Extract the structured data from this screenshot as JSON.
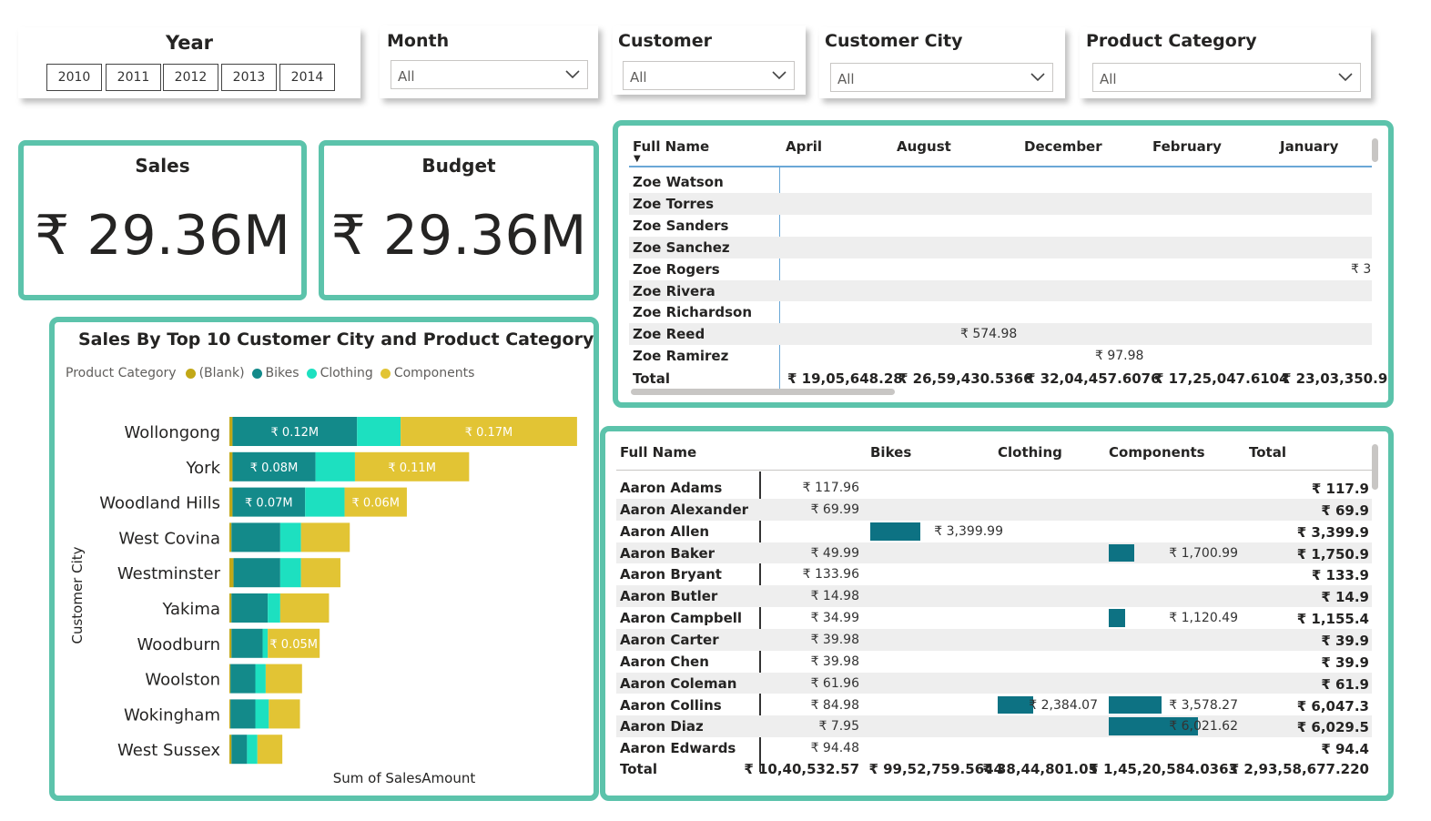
{
  "slicers": {
    "year": {
      "title": "Year",
      "options": [
        "2010",
        "2011",
        "2012",
        "2013",
        "2014"
      ]
    },
    "month": {
      "title": "Month",
      "value": "All"
    },
    "customer": {
      "title": "Customer",
      "value": "All"
    },
    "customer_city": {
      "title": "Customer City",
      "value": "All"
    },
    "product_category": {
      "title": "Product Category",
      "value": "All"
    }
  },
  "cards": {
    "sales": {
      "title": "Sales",
      "value": "₹ 29.36M"
    },
    "budget": {
      "title": "Budget",
      "value": "₹ 29.36M"
    }
  },
  "colors": {
    "accent": "#5cc3ab",
    "blank": "#c2a817",
    "bikes": "#138a8a",
    "clothing": "#1de0c0",
    "components": "#e2c434"
  },
  "chart_data": {
    "type": "bar",
    "title": "Sales By Top 10 Customer City and Product Category",
    "xlabel": "Sum of SalesAmount",
    "ylabel": "Customer City",
    "legend_title": "Product Category",
    "categories": [
      "Wollongong",
      "York",
      "Woodland Hills",
      "West Covina",
      "Westminster",
      "Yakima",
      "Woodburn",
      "Woolston",
      "Wokingham",
      "West Sussex"
    ],
    "series": [
      {
        "name": "(Blank)",
        "values": [
          0.003,
          0.003,
          0.003,
          0.002,
          0.004,
          0.002,
          0.002,
          0.001,
          0.001,
          0.002
        ]
      },
      {
        "name": "Bikes",
        "values": [
          0.12,
          0.08,
          0.07,
          0.047,
          0.045,
          0.035,
          0.03,
          0.024,
          0.024,
          0.015
        ]
      },
      {
        "name": "Clothing",
        "values": [
          0.042,
          0.038,
          0.038,
          0.02,
          0.02,
          0.012,
          0.005,
          0.01,
          0.013,
          0.01
        ]
      },
      {
        "name": "Components",
        "values": [
          0.17,
          0.11,
          0.06,
          0.047,
          0.038,
          0.047,
          0.05,
          0.035,
          0.03,
          0.024
        ]
      }
    ],
    "data_labels": [
      [
        "₹ 0.12M",
        "₹ 0.17M"
      ],
      [
        "₹ 0.08M",
        "₹ 0.11M"
      ],
      [
        "₹ 0.07M",
        "₹ 0.06M"
      ],
      [],
      [],
      [],
      [
        "",
        "₹ 0.05M"
      ],
      [],
      [],
      []
    ]
  },
  "matrix_months": {
    "headers": [
      "Full Name",
      "April",
      "August",
      "December",
      "February",
      "January"
    ],
    "rows": [
      {
        "name": "Zoe Watson",
        "cells": [
          "",
          "",
          "",
          "",
          ""
        ]
      },
      {
        "name": "Zoe Torres",
        "cells": [
          "",
          "",
          "",
          "",
          ""
        ]
      },
      {
        "name": "Zoe Sanders",
        "cells": [
          "",
          "",
          "",
          "",
          ""
        ]
      },
      {
        "name": "Zoe Sanchez",
        "cells": [
          "",
          "",
          "",
          "",
          ""
        ]
      },
      {
        "name": "Zoe Rogers",
        "cells": [
          "",
          "",
          "",
          "",
          "₹ 3"
        ]
      },
      {
        "name": "Zoe Rivera",
        "cells": [
          "",
          "",
          "",
          "",
          ""
        ]
      },
      {
        "name": "Zoe Richardson",
        "cells": [
          "",
          "",
          "",
          "",
          ""
        ]
      },
      {
        "name": "Zoe Reed",
        "cells": [
          "",
          "₹ 574.98",
          "",
          "",
          ""
        ]
      },
      {
        "name": "Zoe Ramirez",
        "cells": [
          "",
          "",
          "₹ 97.98",
          "",
          ""
        ]
      }
    ],
    "total": {
      "label": "Total",
      "cells": [
        "₹ 19,05,648.28",
        "₹ 26,59,430.5366",
        "₹ 32,04,457.6076",
        "₹ 17,25,047.6104",
        "₹ 23,03,350.9"
      ]
    }
  },
  "matrix_category": {
    "headers": [
      "Full Name",
      "Bikes",
      "Clothing",
      "Components",
      "Total"
    ],
    "rows": [
      {
        "name": "Aaron Adams",
        "blank": "₹ 117.96",
        "bikes": "",
        "clothing": "",
        "components": "",
        "total": "₹ 117.9"
      },
      {
        "name": "Aaron Alexander",
        "blank": "₹ 69.99",
        "bikes": "",
        "clothing": "",
        "components": "",
        "total": "₹ 69.9"
      },
      {
        "name": "Aaron Allen",
        "blank": "",
        "bikes": "₹ 3,399.99",
        "clothing": "",
        "components": "",
        "total": "₹ 3,399.9"
      },
      {
        "name": "Aaron Baker",
        "blank": "₹ 49.99",
        "bikes": "",
        "clothing": "",
        "components": "₹ 1,700.99",
        "total": "₹ 1,750.9"
      },
      {
        "name": "Aaron Bryant",
        "blank": "₹ 133.96",
        "bikes": "",
        "clothing": "",
        "components": "",
        "total": "₹ 133.9"
      },
      {
        "name": "Aaron Butler",
        "blank": "₹ 14.98",
        "bikes": "",
        "clothing": "",
        "components": "",
        "total": "₹ 14.9"
      },
      {
        "name": "Aaron Campbell",
        "blank": "₹ 34.99",
        "bikes": "",
        "clothing": "",
        "components": "₹ 1,120.49",
        "total": "₹ 1,155.4"
      },
      {
        "name": "Aaron Carter",
        "blank": "₹ 39.98",
        "bikes": "",
        "clothing": "",
        "components": "",
        "total": "₹ 39.9"
      },
      {
        "name": "Aaron Chen",
        "blank": "₹ 39.98",
        "bikes": "",
        "clothing": "",
        "components": "",
        "total": "₹ 39.9"
      },
      {
        "name": "Aaron Coleman",
        "blank": "₹ 61.96",
        "bikes": "",
        "clothing": "",
        "components": "",
        "total": "₹ 61.9"
      },
      {
        "name": "Aaron Collins",
        "blank": "₹ 84.98",
        "bikes": "",
        "clothing": "₹ 2,384.07",
        "components": "₹ 3,578.27",
        "total": "₹ 6,047.3"
      },
      {
        "name": "Aaron Diaz",
        "blank": "₹ 7.95",
        "bikes": "",
        "clothing": "",
        "components": "₹ 6,021.62",
        "total": "₹ 6,029.5"
      },
      {
        "name": "Aaron Edwards",
        "blank": "₹ 94.48",
        "bikes": "",
        "clothing": "",
        "components": "",
        "total": "₹ 94.4"
      }
    ],
    "total": {
      "label": "Total",
      "blank": "₹ 10,40,532.57",
      "bikes": "₹ 99,52,759.5644",
      "clothing": "₹ 38,44,801.05",
      "components": "₹ 1,45,20,584.0363",
      "total": "₹ 2,93,58,677.220"
    },
    "bar_values": {
      "bikes": [
        0,
        0,
        3399.99,
        0,
        0,
        0,
        0,
        0,
        0,
        0,
        0,
        0,
        0
      ],
      "clothing": [
        0,
        0,
        0,
        0,
        0,
        0,
        0,
        0,
        0,
        0,
        2384.07,
        0,
        0
      ],
      "components": [
        0,
        0,
        0,
        1700.99,
        0,
        0,
        1120.49,
        0,
        0,
        0,
        3578.27,
        6021.62,
        0
      ]
    }
  }
}
